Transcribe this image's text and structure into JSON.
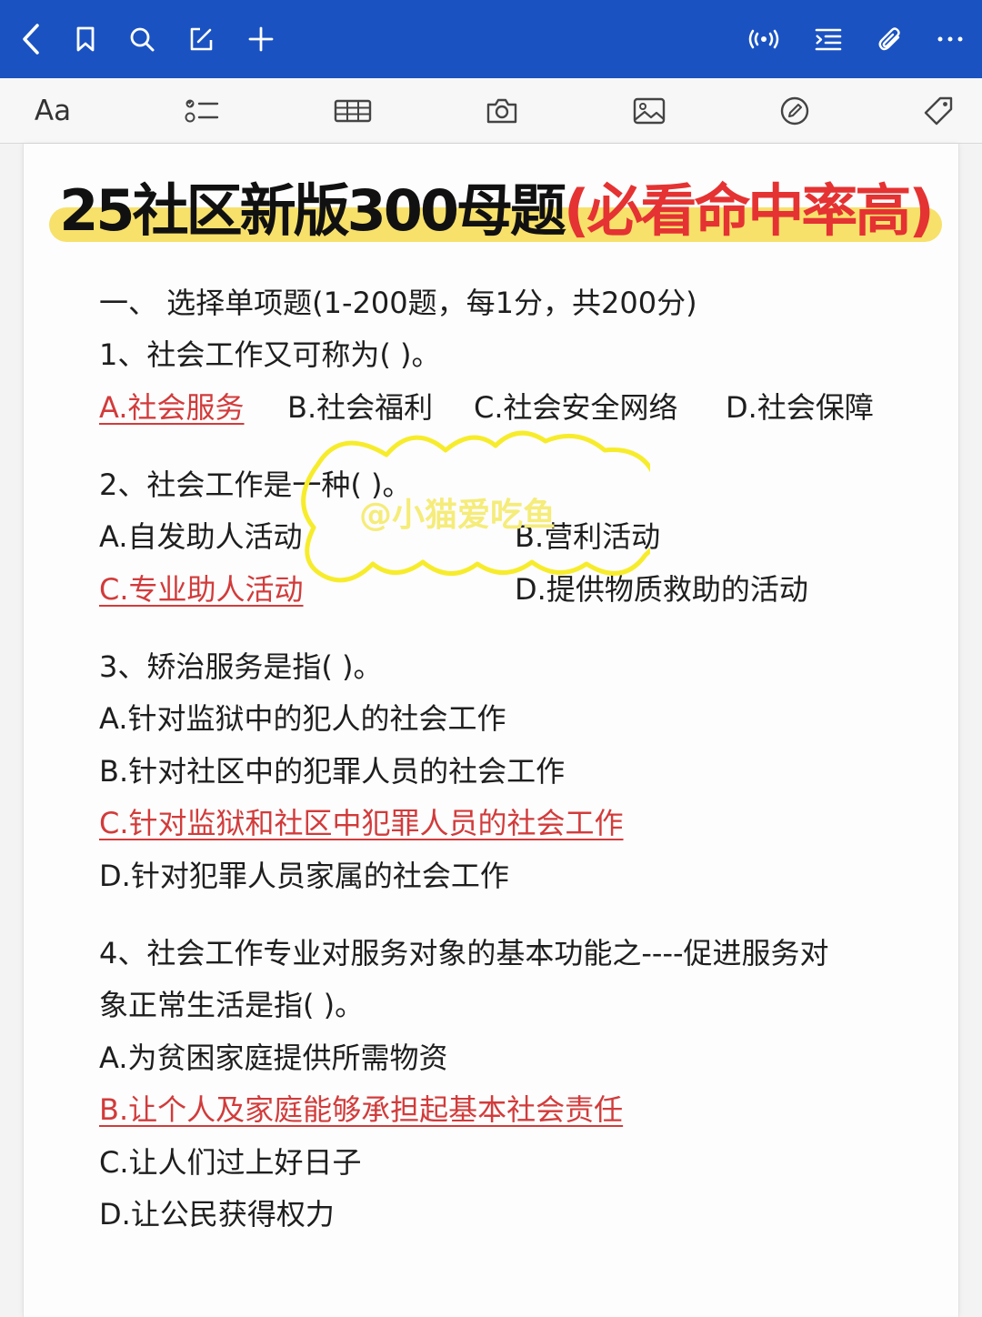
{
  "topbar": {
    "icons": [
      "back-icon",
      "bookmark-icon",
      "search-icon",
      "edit-icon",
      "add-icon",
      "audio-icon",
      "outline-icon",
      "attachment-icon",
      "more-icon"
    ],
    "color": "#1a52c1"
  },
  "toolbar": {
    "text_style_label": "Aa",
    "icons": [
      "text-style-icon",
      "list-icon",
      "table-icon",
      "camera-icon",
      "image-icon",
      "sketch-icon",
      "tag-icon"
    ]
  },
  "title": {
    "main": "25社区新版300母题",
    "highlight": "(必看命中率高)",
    "accent_color": "#e53232",
    "highlight_color": "#f7e16b"
  },
  "section_header": "一、 选择单项题(1-200题，每1分，共200分)",
  "questions": [
    {
      "stem": "1、社会工作又可称为(    )。",
      "options": [
        "A.社会服务",
        "B.社会福利",
        "C.社会安全网络",
        "D.社会保障"
      ],
      "answer": "A"
    },
    {
      "stem": "2、社会工作是一种(    )。",
      "options": [
        "A.自发助人活动",
        "B.营利活动",
        "C.专业助人活动",
        "D.提供物质救助的活动"
      ],
      "answer": "C"
    },
    {
      "stem": "3、矫治服务是指(    )。",
      "options": [
        "A.针对监狱中的犯人的社会工作",
        "B.针对社区中的犯罪人员的社会工作",
        "C.针对监狱和社区中犯罪人员的社会工作",
        "D.针对犯罪人员家属的社会工作"
      ],
      "answer": "C"
    },
    {
      "stem_line1": "4、社会工作专业对服务对象的基本功能之----促进服务对",
      "stem_line2": "象正常生活是指(    )。",
      "options": [
        "A.为贫困家庭提供所需物资",
        "B.让个人及家庭能够承担起基本社会责任",
        "C.让人们过上好日子",
        "D.让公民获得权力"
      ],
      "answer": "B"
    }
  ],
  "watermark": "@小猫爱吃鱼",
  "answer_color": "#d23b3b"
}
